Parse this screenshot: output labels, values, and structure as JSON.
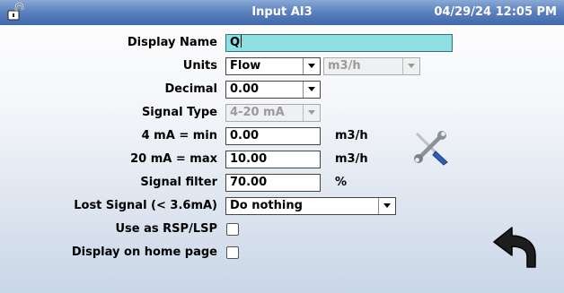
{
  "header": {
    "title": "Input AI3",
    "datetime": "04/29/24 12:05 PM",
    "lock_icon": "lock-open-icon"
  },
  "form": {
    "display_name": {
      "label": "Display Name",
      "value": "Q"
    },
    "units": {
      "label": "Units",
      "type_value": "Flow",
      "unit_value": "m3/h"
    },
    "decimal": {
      "label": "Decimal",
      "value": "0.00"
    },
    "signal_type": {
      "label": "Signal Type",
      "value": "4-20 mA"
    },
    "min": {
      "label": "4 mA = min",
      "value": "0.00",
      "unit": "m3/h"
    },
    "max": {
      "label": "20 mA = max",
      "value": "10.00",
      "unit": "m3/h"
    },
    "filter": {
      "label": "Signal filter",
      "value": "70.00",
      "unit": "%"
    },
    "lost_signal": {
      "label": "Lost Signal (< 3.6mA)",
      "value": "Do nothing"
    },
    "use_rsp": {
      "label": "Use as RSP/LSP",
      "checked": false
    },
    "display_home": {
      "label": "Display on home page",
      "checked": false
    }
  },
  "icons": {
    "tools": "tools-icon",
    "back": "back-arrow-icon"
  },
  "colors": {
    "titlebar": "#4d74b5",
    "active_input": "#8de0df"
  }
}
